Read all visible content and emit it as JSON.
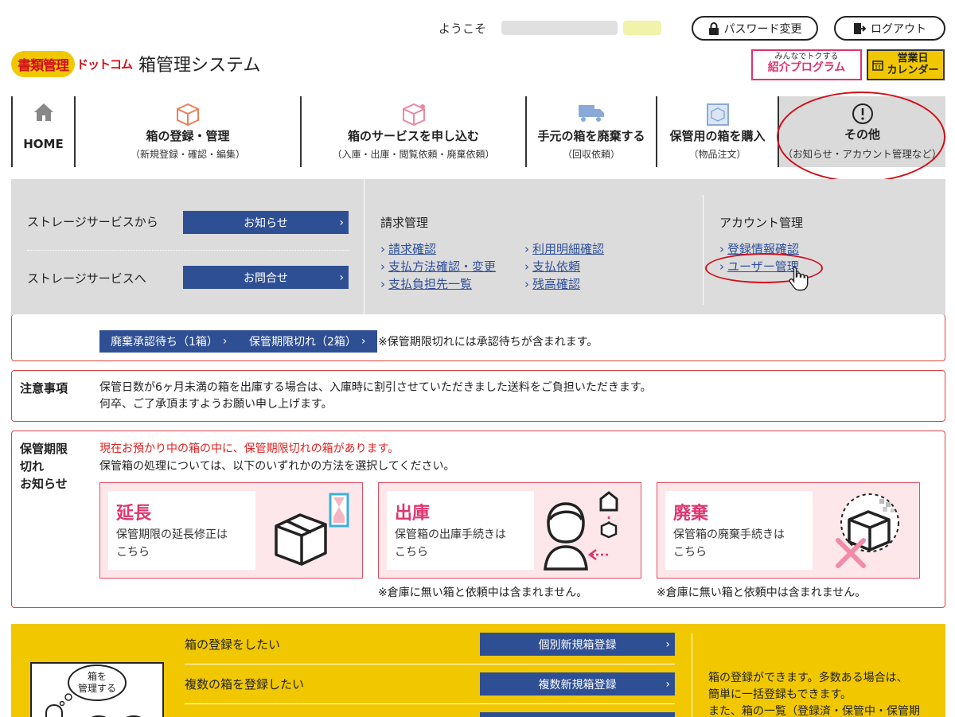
{
  "header": {
    "welcome": "ようこそ",
    "password_button": "パスワード変更",
    "logout_button": "ログアウト",
    "logo_main": "書類管理",
    "logo_dot": "ドットコム",
    "logo_system": "箱管理システム",
    "promo_line1": "みんなでトクする",
    "promo_line2": "紹介プログラム",
    "calendar_line1": "営業日",
    "calendar_line2": "カレンダー"
  },
  "nav": {
    "home": "HOME",
    "items": [
      {
        "label": "箱の登録・管理",
        "sub": "（新規登録・確認・編集）"
      },
      {
        "label": "箱のサービスを申し込む",
        "sub": "（入庫・出庫・閲覧依頼・廃棄依頼）"
      },
      {
        "label": "手元の箱を廃棄する",
        "sub": "（回収依頼）"
      },
      {
        "label": "保管用の箱を購入",
        "sub": "（物品注文）"
      },
      {
        "label": "その他",
        "sub": "（お知らせ・アカウント管理など）"
      }
    ]
  },
  "dropdown": {
    "from_storage": "ストレージサービスから",
    "news_button": "お知らせ",
    "to_storage": "ストレージサービスへ",
    "contact_button": "お問合せ",
    "billing_head": "請求管理",
    "billing_links_col1": [
      "請求確認",
      "支払方法確認・変更",
      "支払負担先一覧"
    ],
    "billing_links_col2": [
      "利用明細確認",
      "支払依頼",
      "残高確認"
    ],
    "account_head": "アカウント管理",
    "account_links": [
      "登録情報確認",
      "ユーザー管理"
    ]
  },
  "status": {
    "disposal_pending": "廃棄承認待ち（1箱）",
    "expired": "保管期限切れ（2箱）",
    "note": "※保管期限切れには承認待ちが含まれます。"
  },
  "notice": {
    "title": "注意事項",
    "line1": "保管日数が6ヶ月未満の箱を出庫する場合は、入庫時に割引させていただきました送料をご負担いただきます。",
    "line2": "何卒、ご了承頂ますようお願い申し上げます。"
  },
  "expire": {
    "title_1": "保管期限",
    "title_2": "切れ",
    "title_3": "お知らせ",
    "alert": "現在お預かり中の箱の中に、保管期限切れの箱があります。",
    "instruction": "保管箱の処理については、以下のいずれかの方法を選択してください。",
    "cards": [
      {
        "title": "延長",
        "desc1": "保管期限の延長修正は",
        "desc2": "こちら"
      },
      {
        "title": "出庫",
        "desc1": "保管箱の出庫手続きは",
        "desc2": "こちら"
      },
      {
        "title": "廃棄",
        "desc1": "保管箱の廃棄手続きは",
        "desc2": "こちら"
      }
    ],
    "card_note": "※倉庫に無い箱と依頼中は含まれません。"
  },
  "register": {
    "illust_text_1": "箱を",
    "illust_text_2": "管理する",
    "row1": "箱の登録をしたい",
    "row1_button": "個別新規箱登録",
    "row2": "複数の箱を登録したい",
    "row2_button": "複数新規箱登録",
    "desc1": "箱の登録ができます。多数ある場合は、",
    "desc2": "簡単に一括登録もできます。",
    "desc3": "また、箱の一覧（登録済・保管中・保管期"
  },
  "colors": {
    "brand_blue": "#2f4f95",
    "accent_red": "#e0346e",
    "yellow": "#f1c800"
  }
}
